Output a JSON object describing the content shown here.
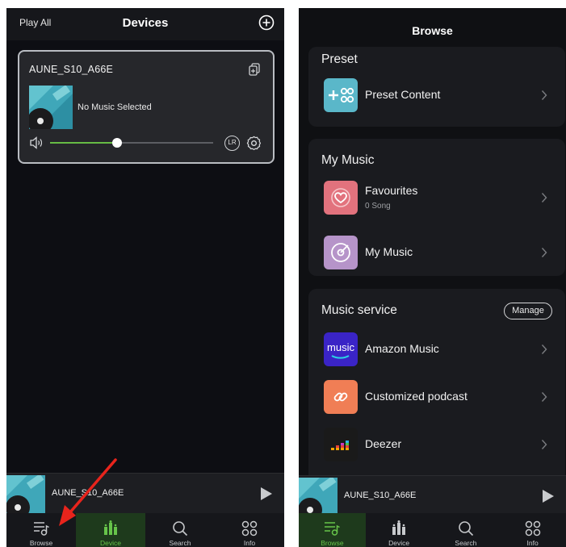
{
  "devices_screen": {
    "header": {
      "play_all": "Play All",
      "title": "Devices"
    },
    "device_card": {
      "name": "AUNE_S10_A66E",
      "now_playing": "No Music Selected",
      "volume_fraction": 0.41,
      "channel_badge": "LR"
    },
    "mini_player": {
      "device_name": "AUNE_S10_A66E"
    },
    "tabs": [
      {
        "label": "Browse",
        "active": false
      },
      {
        "label": "Device",
        "active": true
      },
      {
        "label": "Search",
        "active": false
      },
      {
        "label": "Info",
        "active": false
      }
    ]
  },
  "browse_screen": {
    "header": {
      "title": "Browse"
    },
    "preset": {
      "title": "Preset",
      "items": [
        {
          "label": "Preset Content"
        }
      ]
    },
    "my_music": {
      "title": "My Music",
      "items": [
        {
          "label": "Favourites",
          "sub": "0 Song"
        },
        {
          "label": "My Music"
        }
      ]
    },
    "music_service": {
      "title": "Music service",
      "manage_label": "Manage",
      "items": [
        {
          "label": "Amazon Music",
          "icon_text": "music"
        },
        {
          "label": "Customized podcast"
        },
        {
          "label": "Deezer"
        }
      ]
    },
    "mini_player": {
      "device_name": "AUNE_S10_A66E"
    },
    "tabs": [
      {
        "label": "Browse",
        "active": true
      },
      {
        "label": "Device",
        "active": false
      },
      {
        "label": "Search",
        "active": false
      },
      {
        "label": "Info",
        "active": false
      }
    ]
  },
  "colors": {
    "accent_green": "#67c44a",
    "tab_active_bg": "#1e3a1c",
    "annotation_arrow": "#e8241c"
  }
}
